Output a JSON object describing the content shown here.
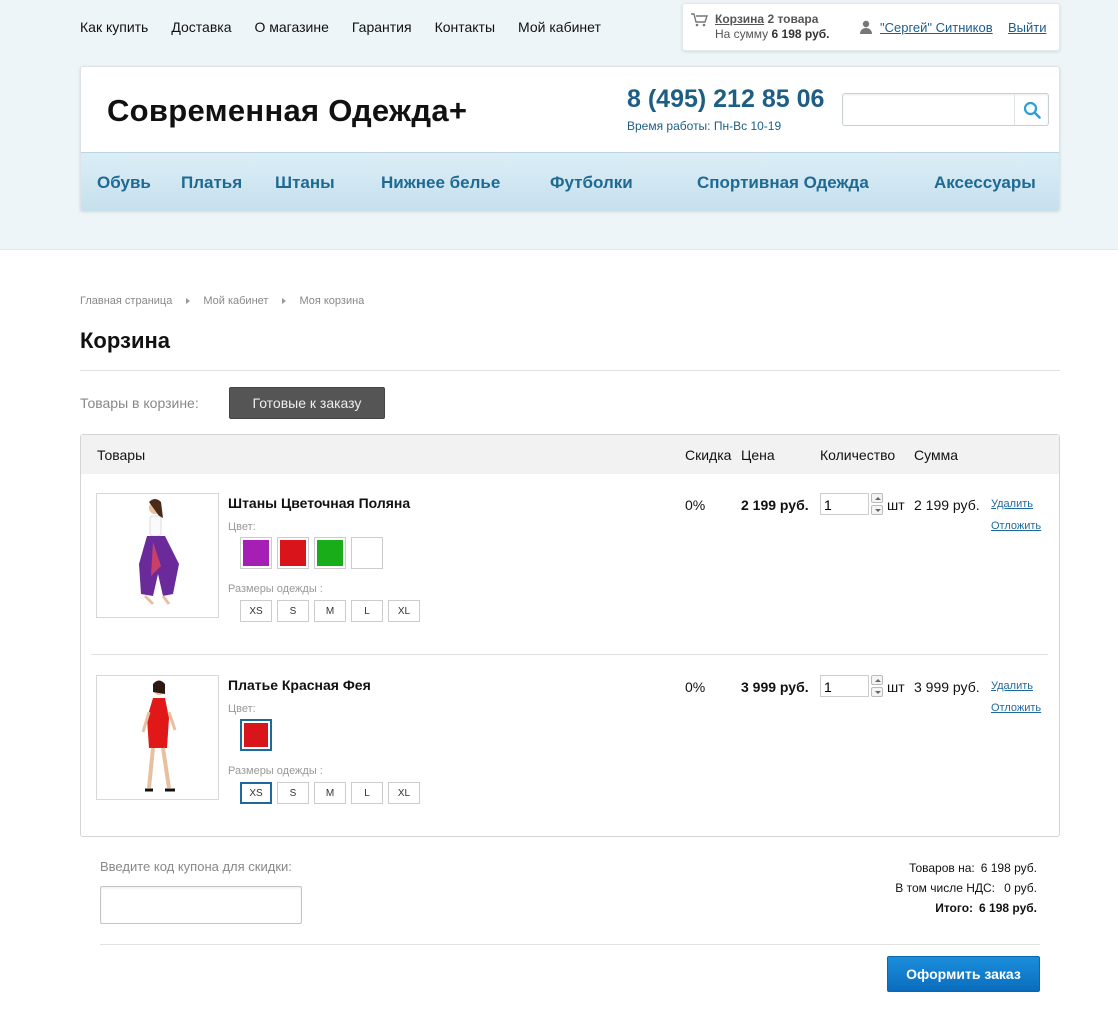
{
  "topnav": [
    "Как купить",
    "Доставка",
    "О магазине",
    "Гарантия",
    "Контакты",
    "Мой кабинет"
  ],
  "cart_widget": {
    "link": "Корзина",
    "count": "2 товара",
    "sum_label": "На сумму",
    "sum_value": "6 198 руб."
  },
  "user": {
    "name": "\"Сергей\" Ситников",
    "logout": "Выйти"
  },
  "header": {
    "logo": "Современная Одежда+",
    "phone": "8 (495) 212 85 06",
    "hours": "Время работы: Пн-Вс 10-19",
    "search_placeholder": ""
  },
  "categories": [
    "Обувь",
    "Платья",
    "Штаны",
    "Нижнее белье",
    "Футболки",
    "Спортивная Одежда",
    "Аксессуары"
  ],
  "breadcrumb": [
    "Главная страница",
    "Мой кабинет",
    "Моя корзина"
  ],
  "page_title": "Корзина",
  "tabs": {
    "label": "Товары в корзине:",
    "ready": "Готовые к заказу"
  },
  "table_headers": {
    "goods": "Товары",
    "discount": "Скидка",
    "price": "Цена",
    "qty": "Количество",
    "sum": "Сумма"
  },
  "items": [
    {
      "name": "Штаны Цветочная Поляна",
      "color_label": "Цвет:",
      "colors": [
        "#a51fb5",
        "#d9141a",
        "#1aad1a",
        "#ffffff"
      ],
      "size_label": "Размеры одежды :",
      "sizes": [
        "XS",
        "S",
        "M",
        "L",
        "XL"
      ],
      "discount": "0%",
      "price": "2 199 руб.",
      "qty": "1",
      "unit": "шт",
      "sum": "2 199 руб.",
      "delete": "Удалить",
      "postpone": "Отложить"
    },
    {
      "name": "Платье Красная Фея",
      "color_label": "Цвет:",
      "colors": [
        "#d9141a"
      ],
      "size_label": "Размеры одежды :",
      "sizes": [
        "XS",
        "S",
        "M",
        "L",
        "XL"
      ],
      "discount": "0%",
      "price": "3 999 руб.",
      "qty": "1",
      "unit": "шт",
      "sum": "3 999 руб.",
      "delete": "Удалить",
      "postpone": "Отложить"
    }
  ],
  "coupon": {
    "label": "Введите код купона для скидки:",
    "value": ""
  },
  "totals": {
    "goods_label": "Товаров на:",
    "goods_value": "6 198 руб.",
    "vat_label": "В том числе НДС:",
    "vat_value": "0 руб.",
    "total_label": "Итого:",
    "total_value": "6 198 руб."
  },
  "checkout_label": "Оформить заказ",
  "colors": {
    "accent": "#1d5e85",
    "link": "#1f6a9c",
    "button": "#0a6cbc"
  }
}
